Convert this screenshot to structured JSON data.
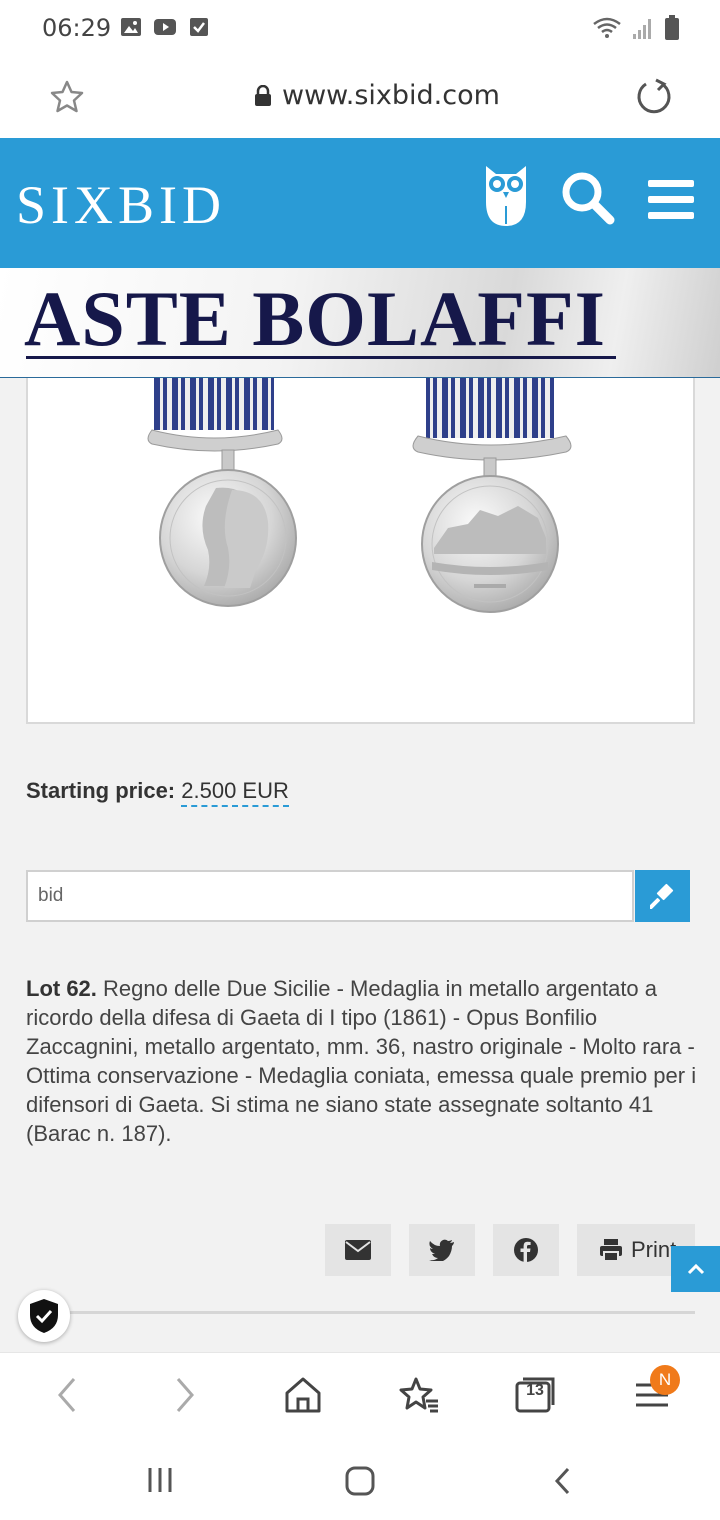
{
  "status_bar": {
    "time": "06:29",
    "icons": [
      "image-icon",
      "youtube-icon",
      "check-box-icon"
    ],
    "right_icons": [
      "wifi-icon",
      "signal-icon",
      "battery-icon"
    ]
  },
  "browser": {
    "url": "www.sixbid.com",
    "tab_count": "13",
    "menu_badge": "N"
  },
  "site": {
    "logo": "SIXBID",
    "banner_name": "ASTE BOLAFFI"
  },
  "lot": {
    "price_label": "Starting price:",
    "price_value": "2.500 EUR",
    "bid_placeholder": "bid",
    "lot_number": "Lot 62.",
    "description": "Regno delle Due Sicilie - Medaglia in metallo argentato a ricordo della difesa di Gaeta di I tipo (1861) - Opus Bonfilio Zaccagnini, metallo argentato, mm. 36, nastro originale - Molto rara - Ottima conservazione - Medaglia coniata, emessa quale premio per i difensori di Gaeta. Si stima ne siano state assegnate soltanto 41 (Barac n. 187)."
  },
  "share": {
    "print_label": "Print"
  },
  "colors": {
    "brand": "#2a9bd6",
    "banner_text": "#16184a",
    "badge": "#f07a1a"
  }
}
